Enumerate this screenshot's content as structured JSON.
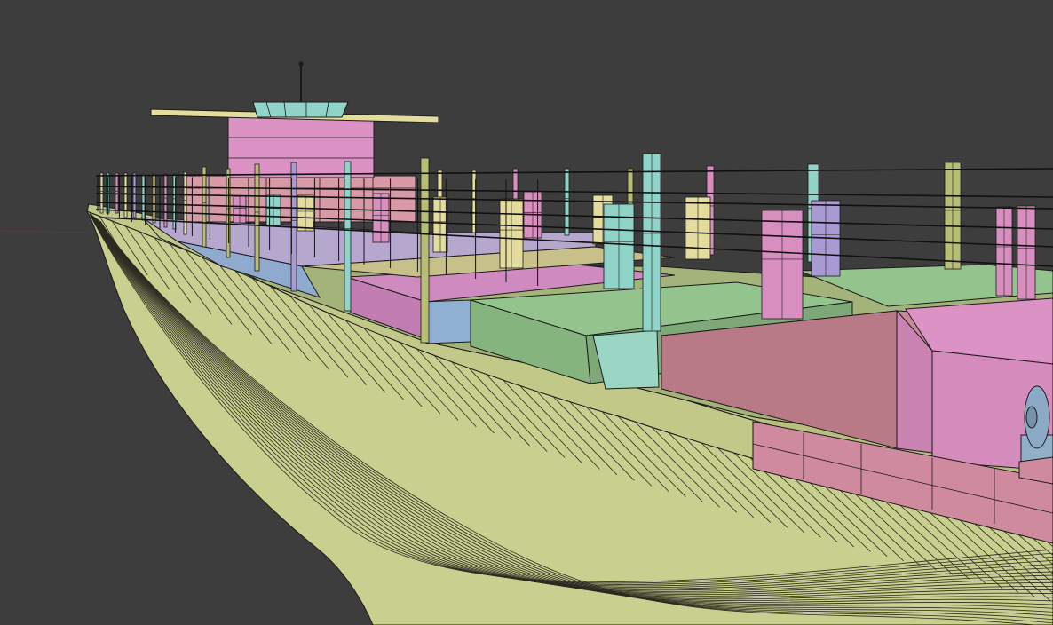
{
  "viewport": {
    "background": "#3d3d3d",
    "wire_color": "#1a1a1a",
    "palette": {
      "hull": "#c9cf8e",
      "hull_shade": "#b3b97c",
      "deck_green": "#93c48e",
      "deck_tan": "#c8c08a",
      "pink": "#d88fc0",
      "rose": "#cf8a9e",
      "lavender": "#a99ad3",
      "blue": "#8fb0d3",
      "cyan": "#8fd3c9",
      "aqua": "#9bd6c4",
      "yellow": "#e4dc9c",
      "olive": "#b8bd76"
    }
  },
  "scene": {
    "subject": "ship-wireframe-model",
    "objects": [
      "hull",
      "deck",
      "cargo-hatches",
      "bridge-superstructure",
      "mast-posts",
      "railings",
      "mooring-winch"
    ]
  }
}
